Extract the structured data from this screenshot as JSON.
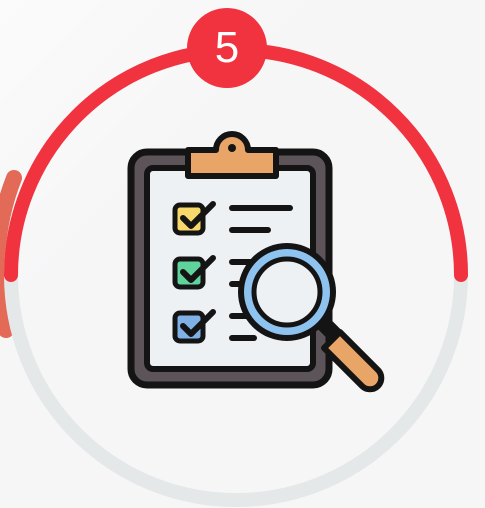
{
  "step_badge": {
    "number": "5",
    "color": "#f1323f"
  },
  "progress_ring": {
    "progress_fraction": 0.5,
    "active_color": "#f1323f",
    "track_color": "#e4e8e9"
  },
  "icon": {
    "name": "clipboard-checklist-magnifier-icon",
    "checkbox_colors": [
      "#f6d86b",
      "#5fd39b",
      "#7fb0e6"
    ],
    "board_color": "#5c5459",
    "paper_color": "#eef1f4",
    "clip_color": "#e9a567",
    "lens_ring_color": "#8ec3f0",
    "handle_color": "#e9a567"
  }
}
